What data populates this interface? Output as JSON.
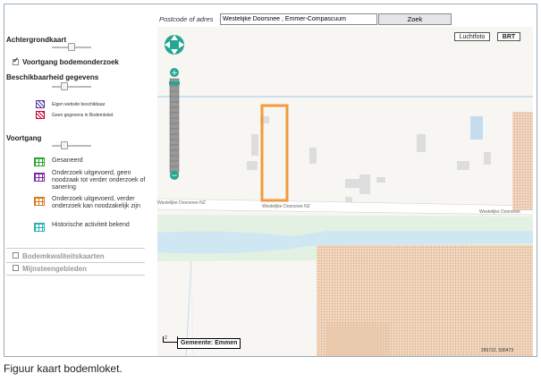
{
  "search": {
    "label": "Postcode of adres",
    "value": "Westelijke Doorsnee , Emmer-Compascuum",
    "button": "Zoek"
  },
  "map_buttons": {
    "luchtfoto": "Luchtfoto",
    "brt": "BRT"
  },
  "sidebar": {
    "achtergrondkaart": "Achtergrondkaart",
    "voortgang_bodem": "Voortgang bodemonderzoek",
    "voortgang_bodem_checked": true,
    "beschikbaarheid": "Beschikbaarheid gegevens",
    "beschik_items": [
      {
        "label": "Eigen website beschikbaar",
        "icon": "hatch-purple-icon"
      },
      {
        "label": "Geen gegevens in Bodemloket",
        "icon": "hatch-red-icon"
      }
    ],
    "voortgang": "Voortgang",
    "voortgang_items": [
      {
        "label": "Gesaneerd",
        "color": "#2aa32a"
      },
      {
        "label": "Onderzoek uitgevoerd, geen noodzaak tot verder onderzoek of sanering",
        "color": "#7a2aa3"
      },
      {
        "label": "Onderzoek uitgevoerd, verder onderzoek kan noodzakelijk zijn",
        "color": "#d4781e"
      },
      {
        "label": "Historische activiteit bekend",
        "color": "#2ab0b0"
      }
    ],
    "bodemkwaliteitskaarten": "Bodemkwaliteitskaarten",
    "mijnsteengebieden": "Mijnsteengebieden"
  },
  "map": {
    "street_labels": [
      "Westelijke Doorsnee NZ",
      "Westelijke Doorsnee NZ",
      "Westelijke Doorsnee"
    ],
    "gemeente": "Gemeente: Emmen",
    "scale_label": "2",
    "coordinates": "265722, 536473"
  },
  "caption": "Figuur kaart bodemloket."
}
